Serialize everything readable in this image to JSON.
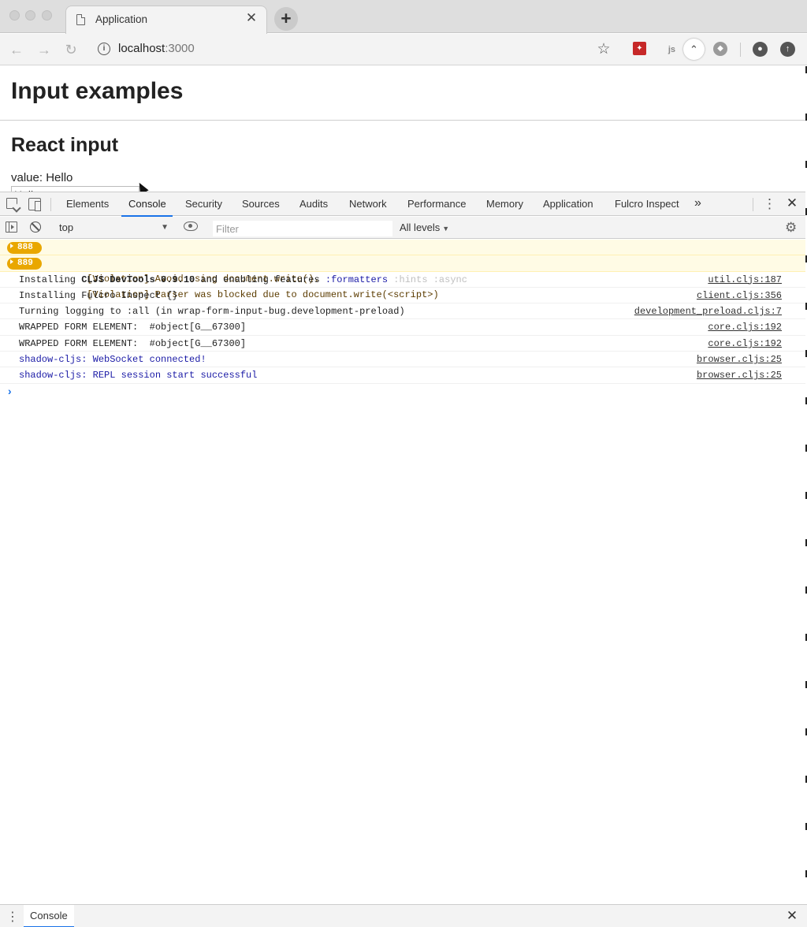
{
  "browser": {
    "tab_title": "Application",
    "tab_close": "✕",
    "new_tab": "+",
    "url_host": "localhost",
    "url_port": ":3000",
    "back": "←",
    "forward": "→",
    "reload": "↻",
    "info": "i",
    "star": "☆"
  },
  "page": {
    "heading": "Input examples",
    "subheading": "React input",
    "value_line": "value: Hello",
    "input_value": "Hello"
  },
  "devtools": {
    "tabs": [
      {
        "label": "Elements"
      },
      {
        "label": "Console"
      },
      {
        "label": "Security"
      },
      {
        "label": "Sources"
      },
      {
        "label": "Audits"
      },
      {
        "label": "Network"
      },
      {
        "label": "Performance"
      },
      {
        "label": "Memory"
      },
      {
        "label": "Application"
      },
      {
        "label": "Fulcro Inspect"
      }
    ],
    "active_tab": "Console",
    "more": "»",
    "kebab": "⋮",
    "close": "✕",
    "context": "top",
    "context_arrow": "▼",
    "filter_placeholder": "Filter",
    "levels": "All levels",
    "levels_arrow": "▼",
    "gear": "⚙"
  },
  "console": {
    "warnings": [
      {
        "count": "888",
        "text": "[Violation] Avoid using document.write()."
      },
      {
        "count": "889",
        "text": "[Violation] Parser was blocked due to document.write(<script>)"
      }
    ],
    "devtools_line": {
      "prefix": "Installing ",
      "bold": "CLJS DevTools 0.9.10",
      "mid": " and enabling features ",
      "kw": ":formatters",
      "dim": " :hints :async",
      "src": "util.cljs:187"
    },
    "lines": [
      {
        "text": "Installing Fulcro Inspect {}",
        "src": "client.cljs:356"
      },
      {
        "text": "Turning logging to :all (in wrap-form-input-bug.development-preload)",
        "src": "development_preload.cljs:7"
      },
      {
        "text": "WRAPPED FORM ELEMENT:  #object[G__67300]",
        "src": "core.cljs:192"
      },
      {
        "text": "WRAPPED FORM ELEMENT:  #object[G__67300]",
        "src": "core.cljs:192"
      }
    ],
    "blue_lines": [
      {
        "text": "shadow-cljs: WebSocket connected!",
        "src": "browser.cljs:25"
      },
      {
        "text": "shadow-cljs: REPL session start successful",
        "src": "browser.cljs:25"
      }
    ],
    "prompt": "›"
  },
  "drawer": {
    "kebab": "⋮",
    "tab": "Console",
    "close": "✕"
  },
  "colors": {
    "accent": "#1a73e8",
    "warning_badge": "#e9a700",
    "warning_bg": "#fffbe5",
    "console_blue": "#1a1aa6"
  }
}
